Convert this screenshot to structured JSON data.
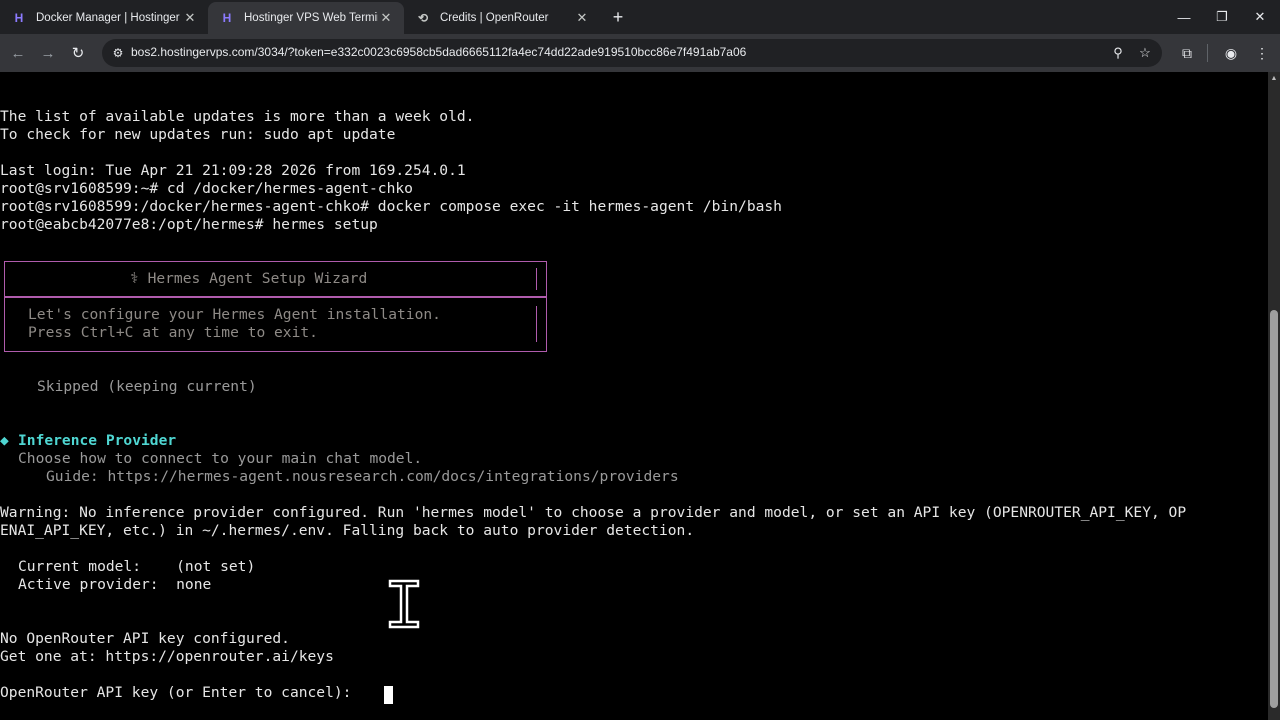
{
  "browser": {
    "tabs": [
      {
        "title": "Docker Manager | Hostinger",
        "favicon": "hostinger-logo",
        "active": false
      },
      {
        "title": "Hostinger VPS Web Terminal",
        "favicon": "hostinger-logo",
        "active": true
      },
      {
        "title": "Credits | OpenRouter",
        "favicon": "openrouter-logo",
        "active": false
      }
    ],
    "url": "bos2.hostingervps.com/3034/?token=e332c0023c6958cb5dad6665112fa4ec74dd22ade919510bcc86e7f491ab7a06"
  },
  "terminal": {
    "lines": [
      "The list of available updates is more than a week old.",
      "To check for new updates run: sudo apt update",
      "",
      "Last login: Tue Apr 21 21:09:28 2026 from 169.254.0.1",
      "root@srv1608599:~# cd /docker/hermes-agent-chko",
      "root@srv1608599:/docker/hermes-agent-chko# docker compose exec -it hermes-agent /bin/bash",
      "root@eabcb42077e8:/opt/hermes# hermes setup"
    ],
    "wizard": {
      "title": "⚕ Hermes Agent Setup Wizard",
      "body1": "Let's configure your Hermes Agent installation.",
      "body2": "Press Ctrl+C at any time to exit."
    },
    "skipped": "Skipped (keeping current)",
    "section": {
      "bullet": "◆",
      "title": "Inference Provider",
      "desc": "Choose how to connect to your main chat model.",
      "guide": "Guide: https://hermes-agent.nousresearch.com/docs/integrations/providers"
    },
    "warning1": "Warning: No inference provider configured. Run 'hermes model' to choose a provider and model, or set an API key (OPENROUTER_API_KEY, OP",
    "warning2": "ENAI_API_KEY, etc.) in ~/.hermes/.env. Falling back to auto provider detection.",
    "current_model": "Current model:    (not set)",
    "active_provider": "Active provider:  none",
    "no_key": "No OpenRouter API key configured.",
    "get_one": "Get one at: https://openrouter.ai/keys",
    "prompt": "OpenRouter API key (or Enter to cancel): "
  }
}
